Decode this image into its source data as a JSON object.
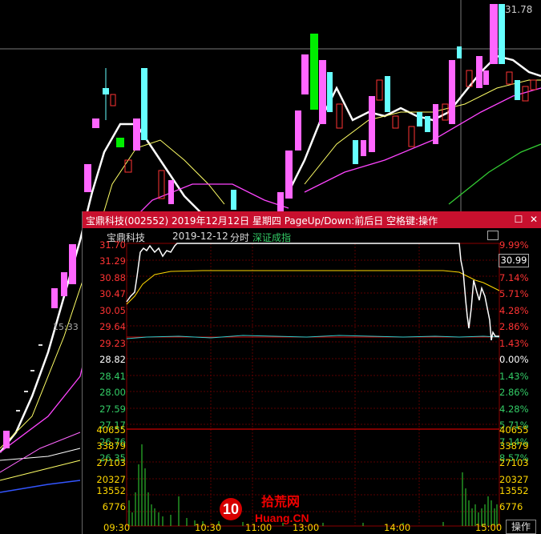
{
  "kline": {
    "price_label_top": "31.78",
    "crosshair_price": "31.78",
    "time_marker": "15:33"
  },
  "popup": {
    "title": "宝鼎科技(002552) 2019年12月12日 星期四 PageUp/Down:前后日 空格键:操作",
    "header_name": "宝鼎科技",
    "header_date": "2019-12-12",
    "header_mode": "分时",
    "header_ref": "深证成指",
    "current_price_box": "30.99",
    "price_left": [
      "31.70",
      "31.29",
      "30.88",
      "30.47",
      "30.05",
      "29.64",
      "29.23",
      "28.82",
      "28.41",
      "28.00",
      "27.59",
      "27.17",
      "26.76",
      "26.35"
    ],
    "pct_right": [
      "9.99%",
      "8.57%",
      "7.14%",
      "5.71%",
      "4.28%",
      "2.86%",
      "1.43%",
      "0.00%",
      "1.43%",
      "2.86%",
      "4.28%",
      "5.71%",
      "7.14%",
      "8.57%"
    ],
    "vol_left": [
      "40655",
      "33879",
      "27103",
      "20327",
      "13552",
      "6776"
    ],
    "vol_right": [
      "40655",
      "33879",
      "27103",
      "20327",
      "13552",
      "6776"
    ],
    "time_labels": [
      "09:30",
      "10:30",
      "11:00",
      "13:00",
      "14:00",
      "15:00"
    ],
    "action_label": "操作",
    "colors": {
      "up": "#ff3333",
      "down": "#00cc66",
      "neutral": "#cccccc",
      "title_bar": "#c8102e",
      "avg": "#ffd700"
    }
  },
  "watermark": {
    "brand_cn": "拾荒网",
    "brand_num": "10",
    "brand_domain": "Huang.CN"
  }
}
